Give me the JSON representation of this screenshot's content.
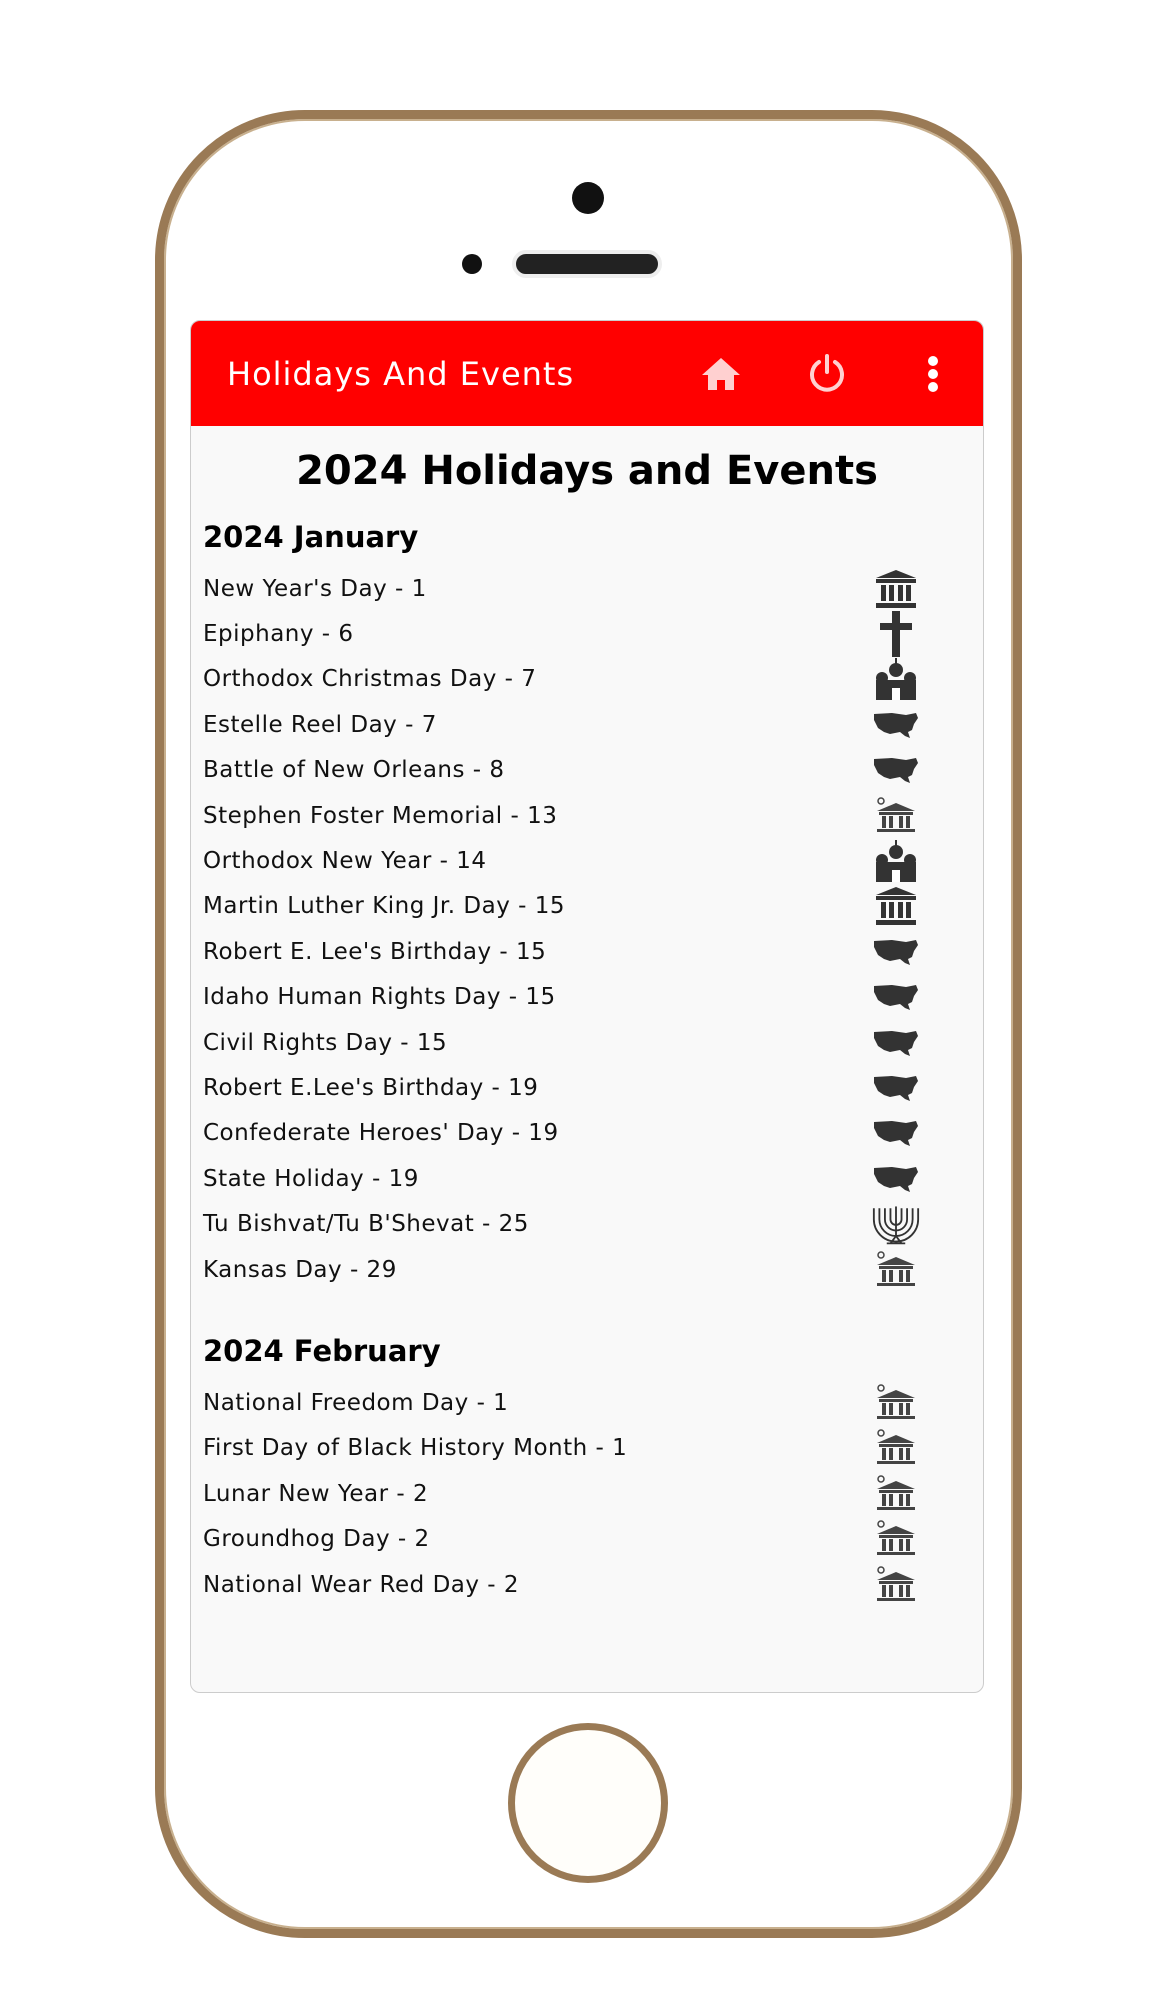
{
  "app": {
    "title": "Holidays And Events",
    "home_icon": "home-icon",
    "power_icon": "power-icon",
    "menu_icon": "more-vert-icon",
    "accent": "#ff0000"
  },
  "page_title": "2024 Holidays and Events",
  "months": [
    {
      "label": "2024 January",
      "events": [
        {
          "name": "New Year's Day - 1",
          "icon": "federal"
        },
        {
          "name": "Epiphany - 6",
          "icon": "cross"
        },
        {
          "name": "Orthodox Christmas Day - 7",
          "icon": "orthodox"
        },
        {
          "name": "Estelle Reel Day - 7",
          "icon": "usmap"
        },
        {
          "name": "Battle of New Orleans - 8",
          "icon": "usmap"
        },
        {
          "name": "Stephen Foster Memorial - 13",
          "icon": "courthouse"
        },
        {
          "name": "Orthodox New Year - 14",
          "icon": "orthodox"
        },
        {
          "name": "Martin Luther King Jr. Day - 15",
          "icon": "federal"
        },
        {
          "name": "Robert E. Lee's Birthday - 15",
          "icon": "usmap"
        },
        {
          "name": "Idaho Human Rights Day - 15",
          "icon": "usmap"
        },
        {
          "name": "Civil Rights Day - 15",
          "icon": "usmap"
        },
        {
          "name": "Robert E.Lee's Birthday - 19",
          "icon": "usmap"
        },
        {
          "name": "Confederate Heroes' Day - 19",
          "icon": "usmap"
        },
        {
          "name": "State Holiday - 19",
          "icon": "usmap"
        },
        {
          "name": "Tu Bishvat/Tu B'Shevat - 25",
          "icon": "menorah"
        },
        {
          "name": "Kansas Day - 29",
          "icon": "courthouse"
        }
      ]
    },
    {
      "label": "2024 February",
      "events": [
        {
          "name": "National Freedom Day - 1",
          "icon": "courthouse"
        },
        {
          "name": "First Day of Black History Month - 1",
          "icon": "courthouse"
        },
        {
          "name": "Lunar New Year - 2",
          "icon": "courthouse"
        },
        {
          "name": "Groundhog Day - 2",
          "icon": "courthouse"
        },
        {
          "name": "National Wear Red Day - 2",
          "icon": "courthouse"
        }
      ]
    }
  ]
}
